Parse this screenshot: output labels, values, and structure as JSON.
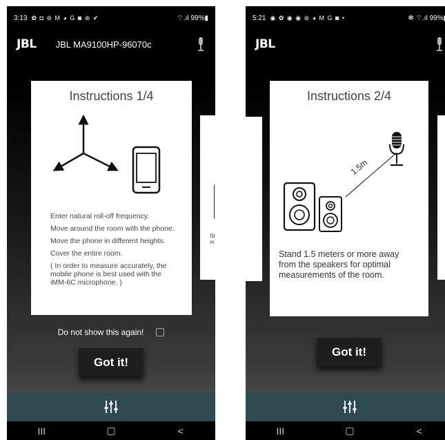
{
  "screens": [
    {
      "status": {
        "time": "3:13",
        "icons": "✿ ◘ ⊚ M ◕ G ◙ ⊛ ✔",
        "right": "⌔.ıl 99%▮"
      },
      "header": {
        "logo": "JBL",
        "device": "JBL MA9100HP-96070c"
      },
      "card": {
        "title": "Instructions 1/4",
        "lines": [
          "Enter natural roll-off frequency.",
          "Move around the room with the phone.",
          "Move the phone in different heights.",
          "Cover the entire room.",
          "( In order to measure accurately, the mobile phone is best used with the iMM-6C microphone. )"
        ]
      },
      "peek_text": "St fro m",
      "checkbox_label": "Do not show this again!",
      "button": "Got it!",
      "nav": {
        "recent": "III",
        "home": "▢",
        "back": "<"
      }
    },
    {
      "status": {
        "time": "5:21",
        "icons": "◉ ✿ ◉ ◉ ⊚ ◕ M G ◙ •",
        "right": "✻ ⌔.ıl 99%▮"
      },
      "header": {
        "logo": "JBL"
      },
      "card": {
        "title": "Instructions 2/4",
        "distance_label": "1.5m",
        "text": "Stand 1.5 meters or more away from the speakers for optimal measurements of the room."
      },
      "button": "Got it!",
      "nav": {
        "recent": "III",
        "home": "▢",
        "back": "<"
      }
    }
  ]
}
